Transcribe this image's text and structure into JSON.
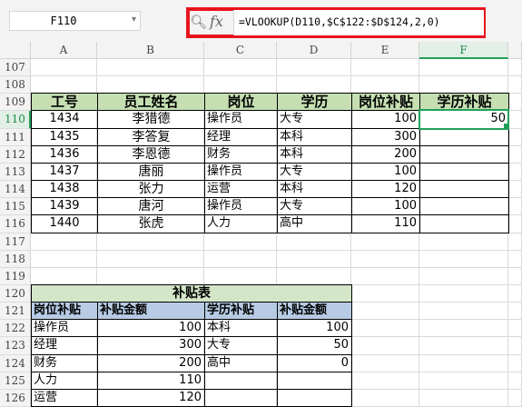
{
  "name_box": "F110",
  "formula": "=VLOOKUP(D110,$C$122:$D$124,2,0)",
  "columns": [
    "A",
    "B",
    "C",
    "D",
    "E",
    "F"
  ],
  "rows": [
    "107",
    "108",
    "109",
    "110",
    "111",
    "112",
    "113",
    "114",
    "115",
    "116",
    "117",
    "118",
    "119",
    "120",
    "121",
    "122",
    "123",
    "124",
    "125",
    "126"
  ],
  "main_table": {
    "headers": [
      "工号",
      "员工姓名",
      "岗位",
      "学历",
      "岗位补贴",
      "学历补贴"
    ],
    "rows": [
      [
        "1434",
        "李猎德",
        "操作员",
        "大专",
        "100",
        "50"
      ],
      [
        "1435",
        "李答复",
        "经理",
        "本科",
        "300",
        ""
      ],
      [
        "1436",
        "李恩德",
        "财务",
        "本科",
        "200",
        ""
      ],
      [
        "1437",
        "唐丽",
        "操作员",
        "大专",
        "100",
        ""
      ],
      [
        "1438",
        "张力",
        "运营",
        "本科",
        "120",
        ""
      ],
      [
        "1439",
        "唐河",
        "操作员",
        "大专",
        "100",
        ""
      ],
      [
        "1440",
        "张虎",
        "人力",
        "高中",
        "110",
        ""
      ]
    ]
  },
  "subsidy_table": {
    "title": "补贴表",
    "headers": [
      "岗位补贴",
      "补贴金额",
      "学历补贴",
      "补贴金额"
    ],
    "rows": [
      [
        "操作员",
        "100",
        "本科",
        "100"
      ],
      [
        "经理",
        "300",
        "大专",
        "50"
      ],
      [
        "财务",
        "200",
        "高中",
        "0"
      ],
      [
        "人力",
        "110",
        "",
        ""
      ],
      [
        "运营",
        "120",
        "",
        ""
      ]
    ]
  },
  "accent_colors": {
    "highlight_box": "#e8141c",
    "selection": "#22a05a",
    "header_green": "#c5dfb3",
    "header_blue": "#b7cbe4"
  }
}
